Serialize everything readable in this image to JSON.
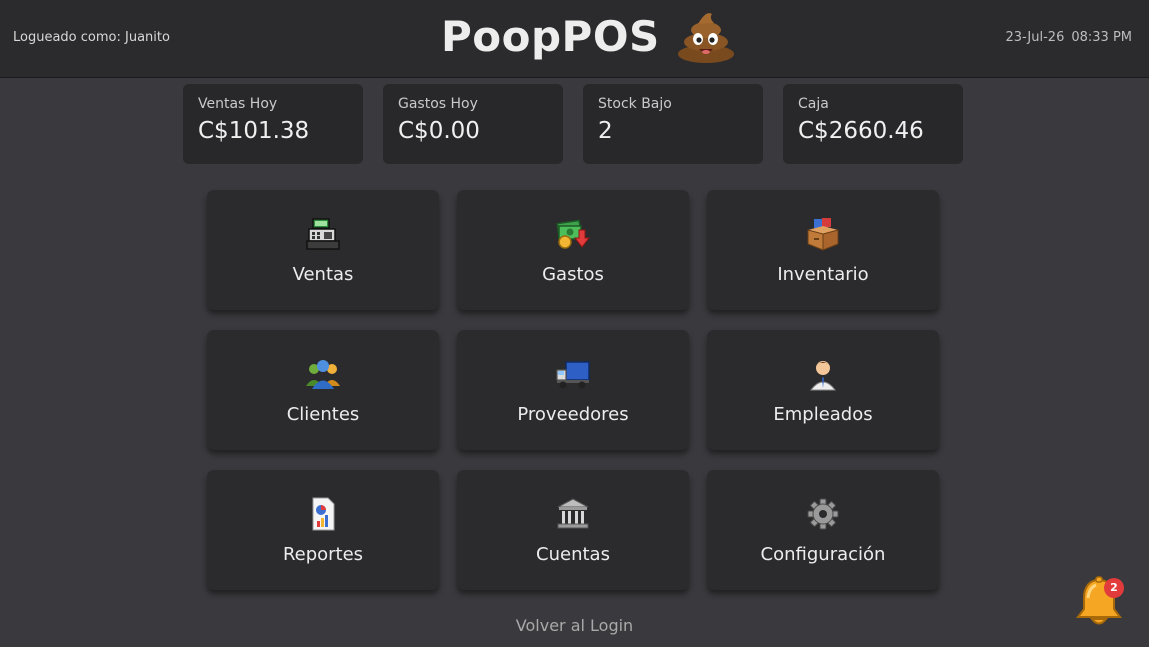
{
  "header": {
    "user_label": "Logueado como: Juanito",
    "app_title": "PoopPOS",
    "date": "23-Jul-26",
    "time": "08:33 PM"
  },
  "stats": [
    {
      "label": "Ventas Hoy",
      "value": "C$101.38"
    },
    {
      "label": "Gastos Hoy",
      "value": "C$0.00"
    },
    {
      "label": "Stock Bajo",
      "value": "2"
    },
    {
      "label": "Caja",
      "value": "C$2660.46"
    }
  ],
  "tiles": [
    {
      "label": "Ventas",
      "icon": "cash-register-icon"
    },
    {
      "label": "Gastos",
      "icon": "money-down-icon"
    },
    {
      "label": "Inventario",
      "icon": "box-icon"
    },
    {
      "label": "Clientes",
      "icon": "users-icon"
    },
    {
      "label": "Proveedores",
      "icon": "truck-icon"
    },
    {
      "label": "Empleados",
      "icon": "employee-icon"
    },
    {
      "label": "Reportes",
      "icon": "report-icon"
    },
    {
      "label": "Cuentas",
      "icon": "bank-icon"
    },
    {
      "label": "Configuración",
      "icon": "gear-icon"
    }
  ],
  "footer": {
    "back_label": "Volver al Login",
    "notifications_count": "2"
  },
  "colors": {
    "background": "#3a393d",
    "header": "#2b2b2d",
    "card": "#28282a",
    "badge": "#e23b3b",
    "bell": "#f5a623"
  }
}
